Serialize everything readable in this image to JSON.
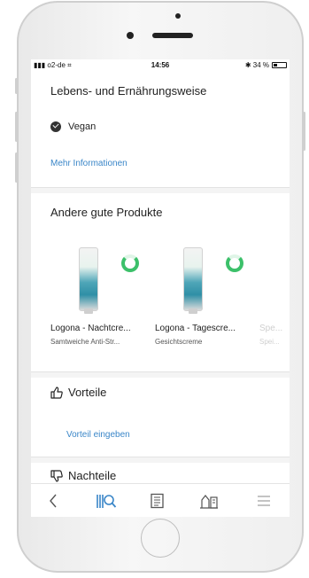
{
  "status_bar": {
    "carrier": "▮▮▮ o2-de ⌗",
    "time": "14:56",
    "battery": "✱ 34 %",
    "battery_level": 0.34
  },
  "lifestyle": {
    "title": "Lebens- und Ernährungsweise",
    "vegan_label": "Vegan",
    "more_info": "Mehr Informationen"
  },
  "other_products": {
    "title": "Andere gute Produkte",
    "items": [
      {
        "name": "Logona - Nachtcre...",
        "subtitle": "Samtweiche Anti-Str..."
      },
      {
        "name": "Logona - Tagescre...",
        "subtitle": "Gesichtscreme"
      },
      {
        "name": "Spe...",
        "subtitle": "Spei..."
      }
    ]
  },
  "advantages": {
    "title": "Vorteile",
    "add_link": "Vorteil eingeben"
  },
  "disadvantages": {
    "title": "Nachteile"
  },
  "tabbar": {
    "items": [
      "back-icon",
      "scan-search-icon",
      "news-icon",
      "compare-icon",
      "menu-icon"
    ],
    "active_color": "#3a86c8"
  }
}
